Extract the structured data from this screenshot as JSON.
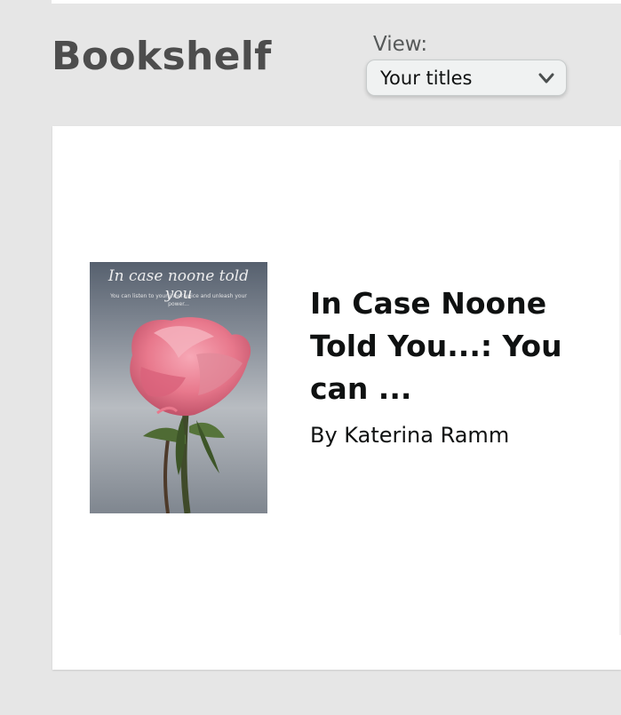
{
  "header": {
    "title": "Bookshelf",
    "view_label": "View:",
    "view_selected": "Your titles"
  },
  "icons": {
    "select_caret": "chevron-down-icon"
  },
  "books": [
    {
      "title": "In Case Noone Told You...: You can ...",
      "author": "By Katerina Ramm",
      "cover_title": "In case noone told you",
      "cover_subtitle": "You can listen to your inner voice and unleash your power..."
    }
  ],
  "colors": {
    "page_background": "#e6e6e6",
    "heading_text": "#4d4d4d",
    "body_text": "#0f1111",
    "cover_rose": "#e8788c",
    "cover_background": "#8b929c"
  }
}
